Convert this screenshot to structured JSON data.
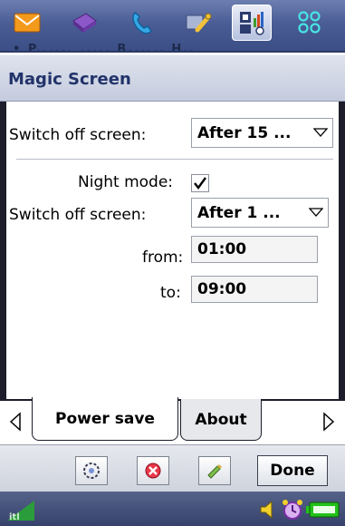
{
  "launcher": {
    "ghost_text": "• P...... ..... B......  H..",
    "apps": [
      {
        "icon": "messages-icon"
      },
      {
        "icon": "contacts-icon"
      },
      {
        "icon": "phone-icon"
      },
      {
        "icon": "tools-icon"
      },
      {
        "icon": "multimedia-icon"
      },
      {
        "icon": "grid-menu-icon"
      }
    ]
  },
  "window": {
    "title": "Magic Screen"
  },
  "settings": {
    "switch_off_label": "Switch off screen:",
    "switch_off_value": "After 15 ...",
    "night_mode_label": "Night mode:",
    "night_mode_checked": true,
    "night_switch_off_label": "Switch off screen:",
    "night_switch_off_value": "After 1 ...",
    "from_label": "from:",
    "from_value": "01:00",
    "to_label": "to:",
    "to_value": "09:00"
  },
  "tabs": [
    {
      "label": "Power save",
      "active": true
    },
    {
      "label": "About",
      "active": false
    }
  ],
  "buttons": {
    "done_label": "Done",
    "soft_icons": [
      "restore-icon",
      "close-icon",
      "edit-icon"
    ]
  },
  "colors": {
    "launcher_bar": "#4a5d95",
    "title_text": "#22336a",
    "battery_green": "#22c21a"
  }
}
